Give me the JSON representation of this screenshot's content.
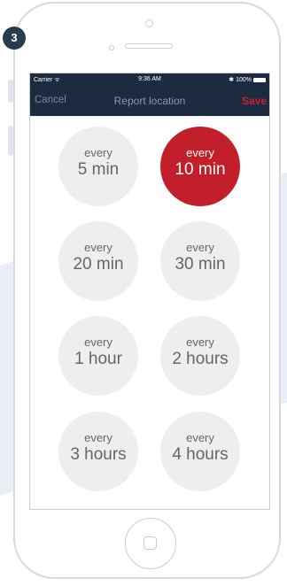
{
  "step_badge": "3",
  "status_bar": {
    "carrier": "Carrier ᯤ",
    "time": "9:36 AM",
    "battery": "✱ 100%"
  },
  "nav": {
    "cancel": "Cancel",
    "title": "Report location",
    "save": "Save"
  },
  "options": [
    {
      "small": "every",
      "big": "5 min",
      "selected": false
    },
    {
      "small": "every",
      "big": "10 min",
      "selected": true
    },
    {
      "small": "every",
      "big": "20 min",
      "selected": false
    },
    {
      "small": "every",
      "big": "30 min",
      "selected": false
    },
    {
      "small": "every",
      "big": "1 hour",
      "selected": false
    },
    {
      "small": "every",
      "big": "2 hours",
      "selected": false
    },
    {
      "small": "every",
      "big": "3 hours",
      "selected": false
    },
    {
      "small": "every",
      "big": "4 hours",
      "selected": false
    }
  ],
  "colors": {
    "nav_background": "#1d2b40",
    "accent_red": "#c31f2a",
    "option_grey": "#eeeeee"
  }
}
